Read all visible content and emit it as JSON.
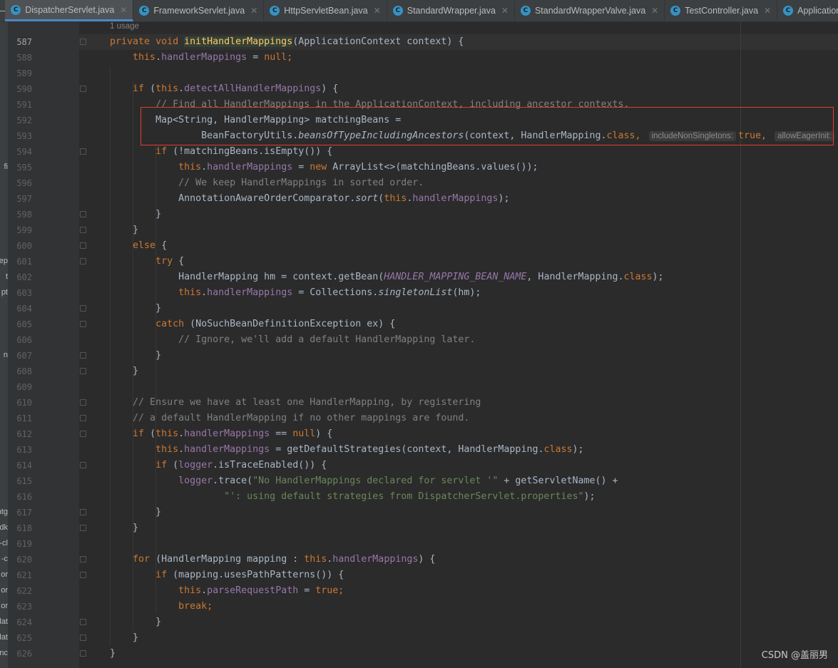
{
  "tabs": [
    {
      "label": "DispatcherServlet.java",
      "active": true
    },
    {
      "label": "FrameworkServlet.java"
    },
    {
      "label": "HttpServletBean.java"
    },
    {
      "label": "StandardWrapper.java"
    },
    {
      "label": "StandardWrapperValve.java"
    },
    {
      "label": "TestController.java"
    },
    {
      "label": "ApplicationFilterChain.java"
    }
  ],
  "usage_hint": "1 usage",
  "left_panel_fragments": [
    {
      "text": "fi",
      "line": 595
    },
    {
      "text": "ep",
      "line": 601
    },
    {
      "text": "t",
      "line": 602
    },
    {
      "text": "pt",
      "line": 603
    },
    {
      "text": "n",
      "line": 607
    },
    {
      "text": "ntg",
      "line": 617
    },
    {
      "text": "dk",
      "line": 618
    },
    {
      "text": "-cl",
      "line": 619
    },
    {
      "text": "-c",
      "line": 620
    },
    {
      "text": "or",
      "line": 621
    },
    {
      "text": "or",
      "line": 622
    },
    {
      "text": "or",
      "line": 623
    },
    {
      "text": "lat",
      "line": 624
    },
    {
      "text": "lat",
      "line": 625
    },
    {
      "text": "nc",
      "line": 626
    }
  ],
  "current_line": 587,
  "highlight_lines": [
    592,
    593
  ],
  "code": [
    {
      "n": 587,
      "fold": true,
      "t": [
        [
          "kw",
          "    private void "
        ],
        [
          "md",
          "initHandlerMappings"
        ],
        [
          "",
          "(ApplicationContext context) {"
        ]
      ]
    },
    {
      "n": 588,
      "t": [
        [
          "kw",
          "        this"
        ],
        [
          "",
          "."
        ],
        [
          "fd",
          "handlerMappings"
        ],
        [
          "",
          " = "
        ],
        [
          "kw",
          "null;"
        ]
      ]
    },
    {
      "n": 589,
      "t": []
    },
    {
      "n": 590,
      "fold": true,
      "t": [
        [
          "kw",
          "        if "
        ],
        [
          "",
          "("
        ],
        [
          "kw",
          "this"
        ],
        [
          "",
          "."
        ],
        [
          "fd",
          "detectAllHandlerMappings"
        ],
        [
          "",
          ") {"
        ]
      ]
    },
    {
      "n": 591,
      "t": [
        [
          "cm",
          "            // Find all HandlerMappings in the ApplicationContext, including ancestor contexts."
        ]
      ]
    },
    {
      "n": 592,
      "t": [
        [
          "",
          "            Map<String, HandlerMapping> matchingBeans ="
        ]
      ]
    },
    {
      "n": 593,
      "t": [
        [
          "",
          "                    BeanFactoryUtils."
        ],
        [
          "it",
          "beansOfTypeIncludingAncestors"
        ],
        [
          "",
          "(context, HandlerMapping."
        ],
        [
          "kw",
          "class, "
        ],
        [
          "hint",
          "includeNonSingletons:"
        ],
        [
          "kw",
          "true, "
        ],
        [
          "hint",
          "allowEagerInit:"
        ]
      ]
    },
    {
      "n": 594,
      "fold": true,
      "t": [
        [
          "kw",
          "            if "
        ],
        [
          "",
          "(!matchingBeans.isEmpty()) {"
        ]
      ]
    },
    {
      "n": 595,
      "t": [
        [
          "kw",
          "                this"
        ],
        [
          "",
          "."
        ],
        [
          "fd",
          "handlerMappings"
        ],
        [
          "",
          " = "
        ],
        [
          "kw",
          "new "
        ],
        [
          "",
          "ArrayList<>(matchingBeans.values());"
        ]
      ]
    },
    {
      "n": 596,
      "t": [
        [
          "cm",
          "                // We keep HandlerMappings in sorted order."
        ]
      ]
    },
    {
      "n": 597,
      "t": [
        [
          "",
          "                AnnotationAwareOrderComparator."
        ],
        [
          "it",
          "sort"
        ],
        [
          "",
          "("
        ],
        [
          "kw",
          "this"
        ],
        [
          "",
          "."
        ],
        [
          "fd",
          "handlerMappings"
        ],
        [
          "",
          ");"
        ]
      ]
    },
    {
      "n": 598,
      "fold": true,
      "t": [
        [
          "",
          "            }"
        ]
      ]
    },
    {
      "n": 599,
      "fold": true,
      "t": [
        [
          "",
          "        }"
        ]
      ]
    },
    {
      "n": 600,
      "fold": true,
      "t": [
        [
          "kw",
          "        else "
        ],
        [
          "",
          "{"
        ]
      ]
    },
    {
      "n": 601,
      "fold": true,
      "t": [
        [
          "kw",
          "            try "
        ],
        [
          "",
          "{"
        ]
      ]
    },
    {
      "n": 602,
      "t": [
        [
          "",
          "                HandlerMapping hm = context.getBean("
        ],
        [
          "cn",
          "HANDLER_MAPPING_BEAN_NAME"
        ],
        [
          "",
          ", HandlerMapping."
        ],
        [
          "kw",
          "class"
        ],
        [
          "",
          ");"
        ]
      ]
    },
    {
      "n": 603,
      "t": [
        [
          "kw",
          "                this"
        ],
        [
          "",
          "."
        ],
        [
          "fd",
          "handlerMappings"
        ],
        [
          "",
          " = Collections."
        ],
        [
          "it",
          "singletonList"
        ],
        [
          "",
          "(hm);"
        ]
      ]
    },
    {
      "n": 604,
      "fold": true,
      "t": [
        [
          "",
          "            }"
        ]
      ]
    },
    {
      "n": 605,
      "fold": true,
      "t": [
        [
          "kw",
          "            catch "
        ],
        [
          "",
          "(NoSuchBeanDefinitionException ex) {"
        ]
      ]
    },
    {
      "n": 606,
      "t": [
        [
          "cm",
          "                // Ignore, we'll add a default HandlerMapping later."
        ]
      ]
    },
    {
      "n": 607,
      "fold": true,
      "t": [
        [
          "",
          "            }"
        ]
      ]
    },
    {
      "n": 608,
      "fold": true,
      "t": [
        [
          "",
          "        }"
        ]
      ]
    },
    {
      "n": 609,
      "t": []
    },
    {
      "n": 610,
      "fold": true,
      "t": [
        [
          "cm",
          "        // Ensure we have at least one HandlerMapping, by registering"
        ]
      ]
    },
    {
      "n": 611,
      "fold": true,
      "t": [
        [
          "cm",
          "        // a default HandlerMapping if no other mappings are found."
        ]
      ]
    },
    {
      "n": 612,
      "fold": true,
      "t": [
        [
          "kw",
          "        if "
        ],
        [
          "",
          "("
        ],
        [
          "kw",
          "this"
        ],
        [
          "",
          "."
        ],
        [
          "fd",
          "handlerMappings"
        ],
        [
          "",
          " == "
        ],
        [
          "kw",
          "null"
        ],
        [
          "",
          ") {"
        ]
      ]
    },
    {
      "n": 613,
      "t": [
        [
          "kw",
          "            this"
        ],
        [
          "",
          "."
        ],
        [
          "fd",
          "handlerMappings"
        ],
        [
          "",
          " = getDefaultStrategies(context, HandlerMapping."
        ],
        [
          "kw",
          "class"
        ],
        [
          "",
          ");"
        ]
      ]
    },
    {
      "n": 614,
      "fold": true,
      "t": [
        [
          "kw",
          "            if "
        ],
        [
          "",
          "("
        ],
        [
          "fd",
          "logger"
        ],
        [
          "",
          ".isTraceEnabled()) {"
        ]
      ]
    },
    {
      "n": 615,
      "t": [
        [
          "fd",
          "                logger"
        ],
        [
          "",
          ".trace("
        ],
        [
          "st",
          "\"No HandlerMappings declared for servlet '\""
        ],
        [
          "",
          " + getServletName() +"
        ]
      ]
    },
    {
      "n": 616,
      "t": [
        [
          "st",
          "                        \"': using default strategies from DispatcherServlet.properties\""
        ],
        [
          "",
          ");"
        ]
      ]
    },
    {
      "n": 617,
      "fold": true,
      "t": [
        [
          "",
          "            }"
        ]
      ]
    },
    {
      "n": 618,
      "fold": true,
      "t": [
        [
          "",
          "        }"
        ]
      ]
    },
    {
      "n": 619,
      "t": []
    },
    {
      "n": 620,
      "fold": true,
      "t": [
        [
          "kw",
          "        for "
        ],
        [
          "",
          "(HandlerMapping mapping : "
        ],
        [
          "kw",
          "this"
        ],
        [
          "",
          "."
        ],
        [
          "fd",
          "handlerMappings"
        ],
        [
          "",
          ") {"
        ]
      ]
    },
    {
      "n": 621,
      "fold": true,
      "t": [
        [
          "kw",
          "            if "
        ],
        [
          "",
          "(mapping.usesPathPatterns()) {"
        ]
      ]
    },
    {
      "n": 622,
      "t": [
        [
          "kw",
          "                this"
        ],
        [
          "",
          "."
        ],
        [
          "fd",
          "parseRequestPath"
        ],
        [
          "",
          " = "
        ],
        [
          "kw",
          "true;"
        ]
      ]
    },
    {
      "n": 623,
      "t": [
        [
          "kw",
          "                break;"
        ]
      ]
    },
    {
      "n": 624,
      "fold": true,
      "t": [
        [
          "",
          "            }"
        ]
      ]
    },
    {
      "n": 625,
      "fold": true,
      "t": [
        [
          "",
          "        }"
        ]
      ]
    },
    {
      "n": 626,
      "fold": true,
      "t": [
        [
          "",
          "    }"
        ]
      ]
    }
  ],
  "watermark": "CSDN @盖丽男"
}
